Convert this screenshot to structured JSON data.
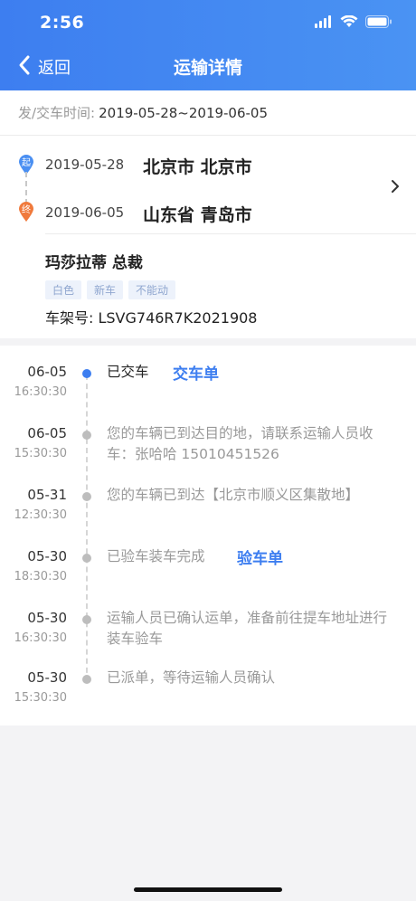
{
  "status_bar": {
    "time": "2:56"
  },
  "nav": {
    "back_label": "返回",
    "title": "运输详情"
  },
  "time_range": {
    "label": "发/交车时间:",
    "value": "2019-05-28~2019-06-05"
  },
  "route": {
    "start": {
      "pin_label": "起",
      "date": "2019-05-28",
      "place": "北京市 北京市"
    },
    "end": {
      "pin_label": "终",
      "date": "2019-06-05",
      "place": "山东省 青岛市"
    }
  },
  "vehicle": {
    "name": "玛莎拉蒂 总裁",
    "tags": [
      "白色",
      "新车",
      "不能动"
    ],
    "vin": "车架号: LSVG746R7K2021908"
  },
  "timeline": [
    {
      "date": "06-05",
      "time": "16:30:30",
      "text": "已交车",
      "link": "交车单",
      "active": true
    },
    {
      "date": "06-05",
      "time": "15:30:30",
      "text": "您的车辆已到达目的地，请联系运输人员收车：张哈哈 15010451526",
      "link": "",
      "active": false
    },
    {
      "date": "05-31",
      "time": "12:30:30",
      "text": "您的车辆已到达【北京市顺义区集散地】",
      "link": "",
      "active": false
    },
    {
      "date": "05-30",
      "time": "18:30:30",
      "text": "已验车装车完成",
      "link": "验车单",
      "active": false
    },
    {
      "date": "05-30",
      "time": "16:30:30",
      "text": "运输人员已确认运单，准备前往提车地址进行装车验车",
      "link": "",
      "active": false
    },
    {
      "date": "05-30",
      "time": "15:30:30",
      "text": "已派单，等待运输人员确认",
      "link": "",
      "active": false
    }
  ],
  "colors": {
    "accent": "#3d7ef0",
    "start_pin": "#4a8ff2",
    "end_pin": "#f07a3c"
  }
}
